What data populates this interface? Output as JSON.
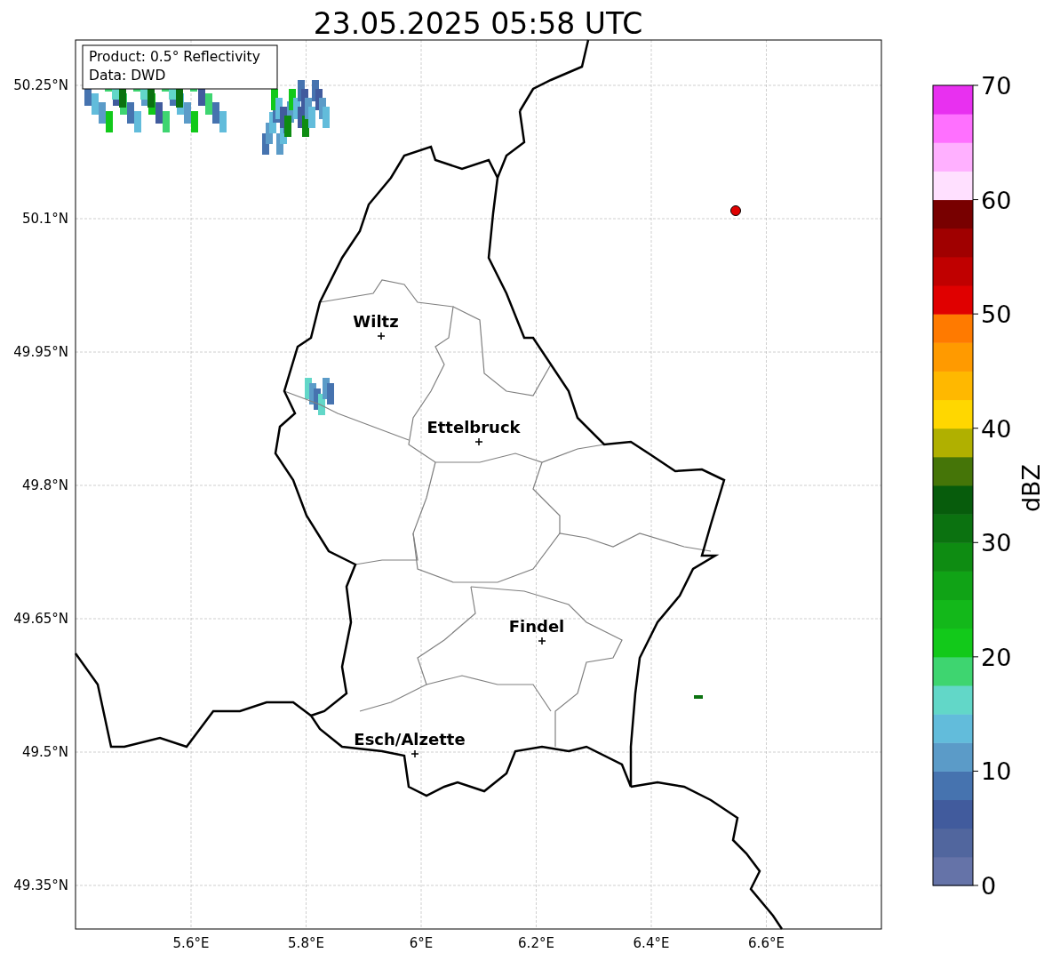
{
  "title": "23.05.2025 05:58 UTC",
  "map": {
    "info_box": [
      "Product: 0.5° Reflectivity",
      "Data: DWD"
    ],
    "lat_ticks": [
      "50.25°N",
      "50.1°N",
      "49.95°N",
      "49.8°N",
      "49.65°N",
      "49.5°N",
      "49.35°N"
    ],
    "lon_ticks": [
      "5.6°E",
      "5.8°E",
      "6°E",
      "6.2°E",
      "6.4°E",
      "6.6°E"
    ],
    "cities": [
      {
        "name": "Wiltz"
      },
      {
        "name": "Ettelbruck"
      },
      {
        "name": "Findel"
      },
      {
        "name": "Esch/Alzette"
      }
    ]
  },
  "colorbar": {
    "label": "dBZ",
    "ticks": [
      "70",
      "60",
      "50",
      "40",
      "30",
      "20",
      "10",
      "0"
    ],
    "bands": [
      {
        "color": "#6573a8"
      },
      {
        "color": "#51669e"
      },
      {
        "color": "#415b9d"
      },
      {
        "color": "#4673af"
      },
      {
        "color": "#5b9bc8"
      },
      {
        "color": "#62bcdb"
      },
      {
        "color": "#62d7c8"
      },
      {
        "color": "#3ed570"
      },
      {
        "color": "#12c91a"
      },
      {
        "color": "#13b81a"
      },
      {
        "color": "#10a316"
      },
      {
        "color": "#0e8c12"
      },
      {
        "color": "#0b7210"
      },
      {
        "color": "#075c0c"
      },
      {
        "color": "#457508"
      },
      {
        "color": "#b0b000"
      },
      {
        "color": "#ffd700"
      },
      {
        "color": "#ffb800"
      },
      {
        "color": "#ff9a00"
      },
      {
        "color": "#ff7a00"
      },
      {
        "color": "#e00000"
      },
      {
        "color": "#c00000"
      },
      {
        "color": "#a00000"
      },
      {
        "color": "#780000"
      },
      {
        "color": "#ffe0ff"
      },
      {
        "color": "#ffb0ff"
      },
      {
        "color": "#ff70ff"
      },
      {
        "color": "#e830f0"
      }
    ]
  }
}
